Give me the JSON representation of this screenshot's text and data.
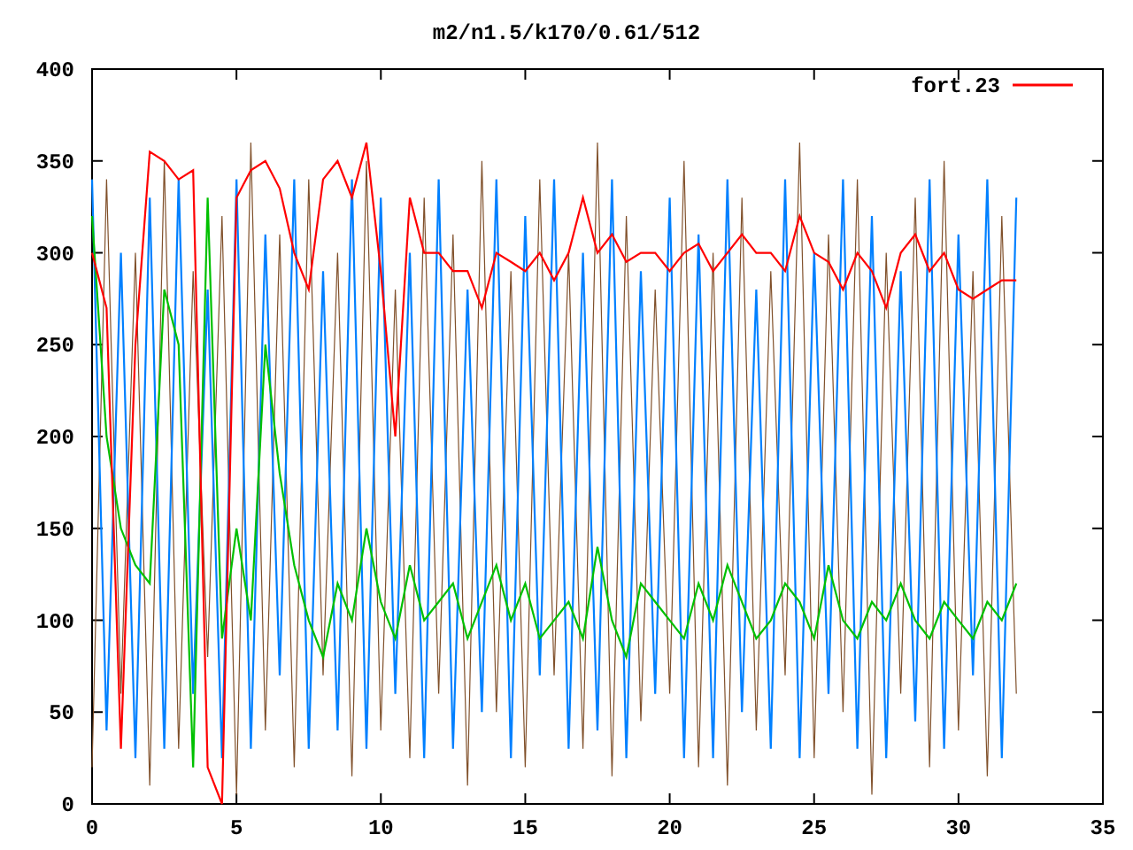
{
  "chart_data": {
    "type": "line",
    "title": "m2/n1.5/k170/0.61/512",
    "xlim": [
      0,
      35
    ],
    "ylim": [
      0,
      400
    ],
    "xticks": [
      0,
      5,
      10,
      15,
      20,
      25,
      30,
      35
    ],
    "yticks": [
      0,
      50,
      100,
      150,
      200,
      250,
      300,
      350,
      400
    ],
    "x": [
      0,
      0.5,
      1,
      1.5,
      2,
      2.5,
      3,
      3.5,
      4,
      4.5,
      5,
      5.5,
      6,
      6.5,
      7,
      7.5,
      8,
      8.5,
      9,
      9.5,
      10,
      10.5,
      11,
      11.5,
      12,
      12.5,
      13,
      13.5,
      14,
      14.5,
      15,
      15.5,
      16,
      16.5,
      17,
      17.5,
      18,
      18.5,
      19,
      19.5,
      20,
      20.5,
      21,
      21.5,
      22,
      22.5,
      23,
      23.5,
      24,
      24.5,
      25,
      25.5,
      26,
      26.5,
      27,
      27.5,
      28,
      28.5,
      29,
      29.5,
      30,
      30.5,
      31,
      31.5,
      32
    ],
    "series": [
      {
        "color": "#80502a",
        "values": [
          20,
          340,
          60,
          300,
          10,
          350,
          30,
          290,
          80,
          320,
          5,
          360,
          40,
          310,
          20,
          340,
          70,
          300,
          15,
          350,
          40,
          280,
          25,
          330,
          60,
          310,
          10,
          350,
          50,
          290,
          20,
          340,
          70,
          300,
          30,
          360,
          15,
          320,
          45,
          280,
          60,
          350,
          20,
          300,
          10,
          330,
          40,
          290,
          70,
          360,
          25,
          310,
          50,
          340,
          5,
          300,
          60,
          330,
          20,
          350,
          40,
          290,
          15,
          320,
          60
        ]
      },
      {
        "color": "#0080ff",
        "values": [
          340,
          40,
          300,
          25,
          330,
          30,
          340,
          60,
          280,
          25,
          340,
          30,
          310,
          70,
          340,
          30,
          290,
          40,
          340,
          30,
          330,
          60,
          300,
          25,
          340,
          30,
          280,
          50,
          340,
          25,
          320,
          70,
          340,
          30,
          300,
          40,
          340,
          25,
          290,
          60,
          330,
          25,
          310,
          25,
          340,
          50,
          280,
          30,
          340,
          25,
          300,
          60,
          340,
          30,
          320,
          25,
          290,
          45,
          340,
          30,
          310,
          70,
          340,
          25,
          330
        ]
      },
      {
        "color": "#00c000",
        "values": [
          320,
          200,
          150,
          130,
          120,
          280,
          250,
          20,
          330,
          90,
          150,
          100,
          250,
          180,
          130,
          100,
          80,
          120,
          100,
          150,
          110,
          90,
          130,
          100,
          110,
          120,
          90,
          110,
          130,
          100,
          120,
          90,
          100,
          110,
          90,
          140,
          100,
          80,
          120,
          110,
          100,
          90,
          120,
          100,
          130,
          110,
          90,
          100,
          120,
          110,
          90,
          130,
          100,
          90,
          110,
          100,
          120,
          100,
          90,
          110,
          100,
          90,
          110,
          100,
          120
        ]
      },
      {
        "name": "fort.23",
        "color": "#ff0000",
        "values": [
          300,
          270,
          30,
          250,
          355,
          350,
          340,
          345,
          20,
          0,
          330,
          345,
          350,
          335,
          300,
          280,
          340,
          350,
          330,
          360,
          290,
          200,
          330,
          300,
          300,
          290,
          290,
          270,
          300,
          295,
          290,
          300,
          285,
          300,
          330,
          300,
          310,
          295,
          300,
          300,
          290,
          300,
          305,
          290,
          300,
          310,
          300,
          300,
          290,
          320,
          300,
          295,
          280,
          300,
          290,
          270,
          300,
          310,
          290,
          300,
          280,
          275,
          280,
          285,
          285
        ]
      }
    ]
  }
}
